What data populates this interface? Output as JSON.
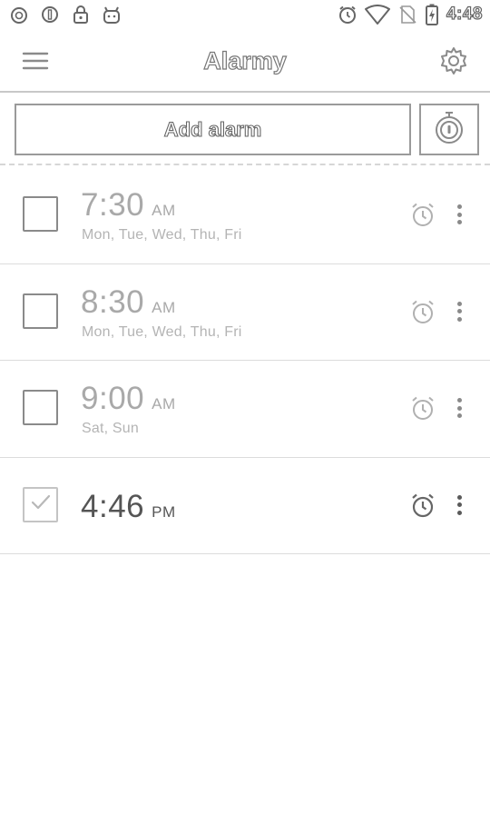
{
  "status_bar": {
    "left_icons": [
      "alarm-status-icon",
      "sync-icon",
      "lock-icon",
      "android-icon"
    ],
    "right_icons": [
      "alarm-clock-icon",
      "wifi-icon",
      "no-sim-icon",
      "battery-charging-icon"
    ],
    "time": "4:48"
  },
  "toolbar": {
    "title": "Alarmy",
    "menu_icon": "hamburger-menu-icon",
    "settings_icon": "gear-icon"
  },
  "actions": {
    "add_alarm_label": "Add alarm",
    "timer_icon": "stopwatch-icon"
  },
  "alarms": [
    {
      "time": "7:30",
      "period": "AM",
      "days": "Mon, Tue, Wed, Thu, Fri",
      "enabled": false
    },
    {
      "time": "8:30",
      "period": "AM",
      "days": "Mon, Tue, Wed, Thu, Fri",
      "enabled": false
    },
    {
      "time": "9:00",
      "period": "AM",
      "days": "Sat, Sun",
      "enabled": false
    },
    {
      "time": "4:46",
      "period": "PM",
      "days": "",
      "enabled": true
    }
  ],
  "colors": {
    "background": "#ffffff",
    "inactive_text": "#a9a9a9",
    "active_text": "#555555",
    "divider": "#dcdcdc"
  }
}
